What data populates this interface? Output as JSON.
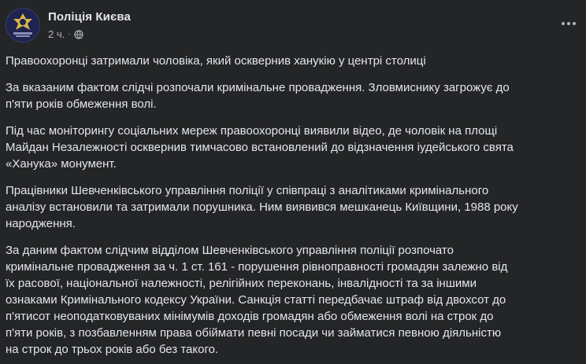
{
  "post": {
    "author": "Поліція Києва",
    "time": "2 ч.",
    "separator": "·",
    "visibility_icon": "globe-icon",
    "more_icon": "more-options-icon",
    "paragraphs": [
      "Правоохоронці затримали чоловіка, який осквернив ханукію у центрі столиці",
      "За вказаним фактом слідчі розпочали кримінальне провадження. Зловмиснику загрожує до\nп'яти років  обмеження волі.",
      "Під час моніторингу соціальних мереж правоохоронці виявили відео, де чоловік на площі\nМайдан Незалежності осквернив тимчасово встановлений до відзначення іудейського свята\n«Ханука» монумент.",
      "Працівники Шевченківського управління поліції у співпраці з аналітиками кримінального\nаналізу встановили та затримали порушника. Ним виявився мешканець Київщини, 1988 року\nнародження.",
      "За даним фактом слідчим відділом Шевченківського управління поліції розпочато\nкримінальне провадження за ч. 1 ст. 161 - порушення рівноправності громадян залежно від\nїх расової, національної належності, релігійних переконань, інвалідності та за іншими\nознаками Кримінального кодексу України. Санкція статті передбачає  штраф від двохсот до\nп'ятисот неоподатковуваних мінімумів доходів громадян або обмеження волі на строк до\nп'яти років, з позбавленням права обіймати певні посади чи займатися певною діяльністю\nна строк до трьох років або без такого."
    ]
  },
  "colors": {
    "background": "#242526",
    "text_primary": "#e4e6eb",
    "text_secondary": "#b0b3b8",
    "avatar_bg": "#2a2f5c",
    "badge_gold": "#d6b64a"
  }
}
